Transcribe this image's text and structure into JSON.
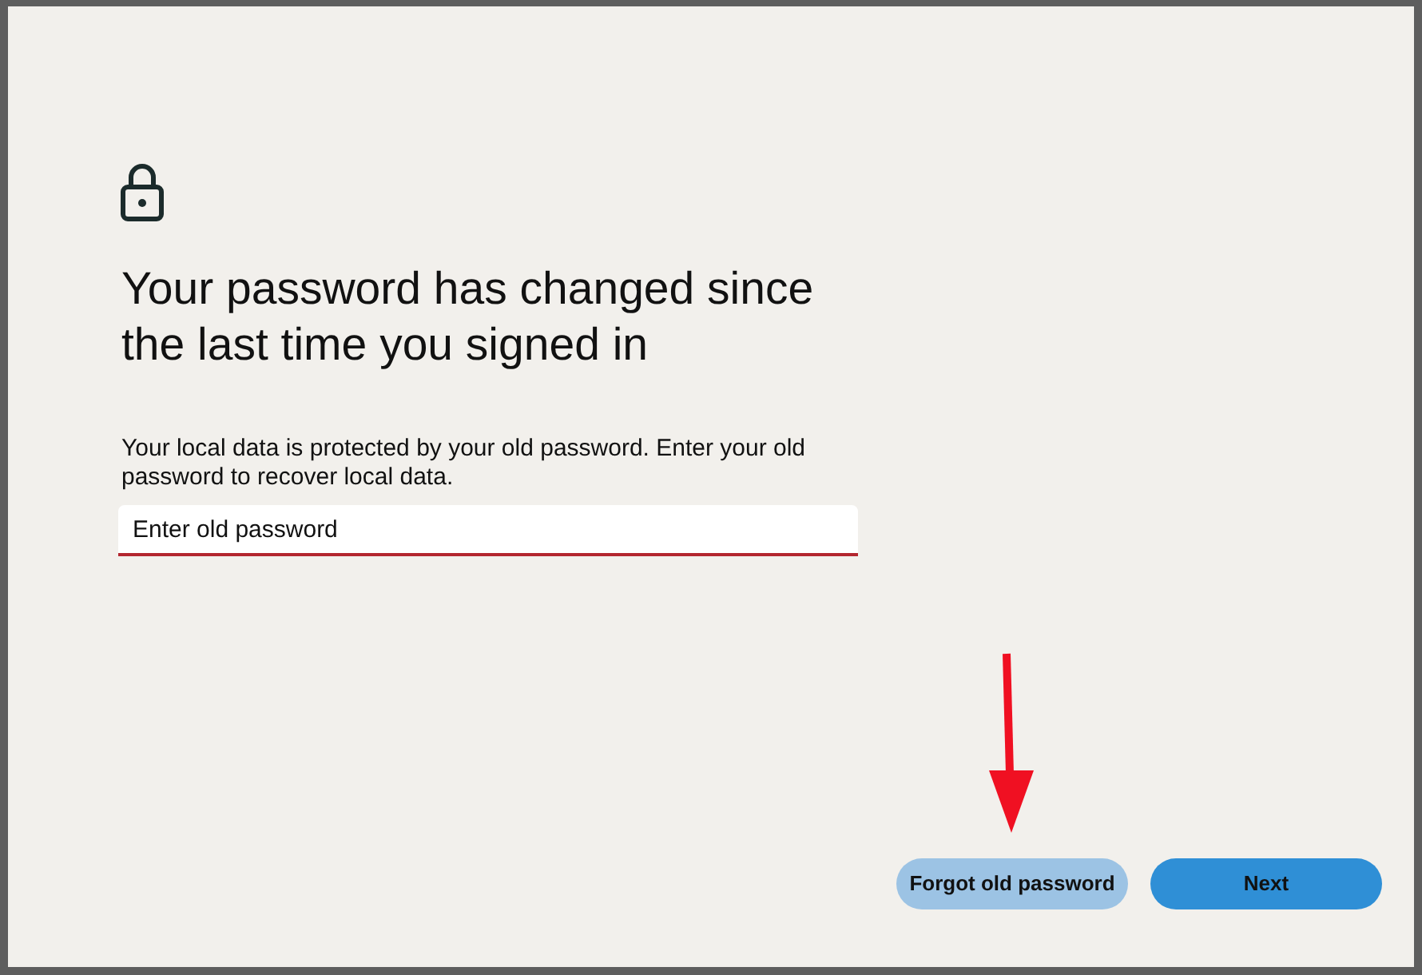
{
  "title": "Your password has changed since the last time you signed in",
  "description": "Your local data is protected by your old password. Enter your old password to recover local data.",
  "password_field": {
    "placeholder": "Enter old password",
    "invalid": true
  },
  "buttons": [
    {
      "label": "Forgot old password",
      "kind": "secondary"
    },
    {
      "label": "Next",
      "kind": "primary"
    }
  ]
}
